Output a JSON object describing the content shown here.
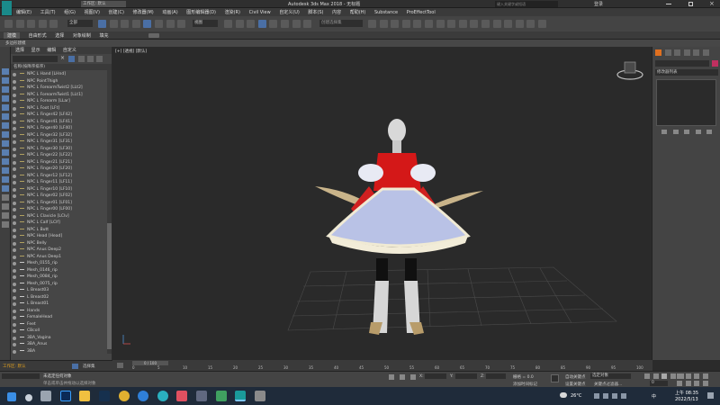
{
  "window": {
    "title": "Autodesk 3ds Max 2018 - 无标题",
    "workspace_label": "工作区: 默认",
    "search_placeholder": "键入关键字或短语",
    "login_label": "登录"
  },
  "menus": [
    "编辑(E)",
    "工具(T)",
    "组(G)",
    "视图(V)",
    "创建(C)",
    "修改器(M)",
    "动画(A)",
    "图形编辑器(D)",
    "渲染(R)",
    "Civil View",
    "自定义(U)",
    "脚本(S)",
    "内容",
    "帮助(H)",
    "Substance",
    "ProEffectTool"
  ],
  "toolbar": {
    "filter_value": "全部",
    "view_value": "视图",
    "named_selection": "创建选择集"
  },
  "ribbon": {
    "tabs": [
      "建模",
      "自由形式",
      "选择",
      "对象绘制",
      "填充"
    ],
    "subtitle": "多边形建模"
  },
  "scene_explorer": {
    "tabs": [
      "选择",
      "显示",
      "编辑",
      "自定义"
    ],
    "header": "名称(按降序排序)",
    "items": [
      "NPC L Hand [LHnd]",
      "NPC PointThigh",
      "NPC L ForearmTwist2 [LLt2]",
      "NPC L ForearmTwist1 [LLt1]",
      "NPC L Forearm [LLar]",
      "NPC L Foot [LFt]",
      "NPC L Finger42 [LF42]",
      "NPC L Finger41 [LF41]",
      "NPC L Finger40 [LF40]",
      "NPC L Finger32 [LF32]",
      "NPC L Finger31 [LF31]",
      "NPC L Finger30 [LF30]",
      "NPC L Finger22 [LF22]",
      "NPC L Finger21 [LF21]",
      "NPC L Finger20 [LF20]",
      "NPC L Finger12 [LF12]",
      "NPC L Finger11 [LF11]",
      "NPC L Finger10 [LF10]",
      "NPC L Finger02 [LF02]",
      "NPC L Finger01 [LF01]",
      "NPC L Finger00 [LF00]",
      "NPC L Clavicle [LClv]",
      "NPC L Calf [LClf]",
      "NPC L Butt",
      "NPC Head [Head]",
      "NPC Belly",
      "NPC Anus Deep2",
      "NPC Anus Deep1",
      "Mesh_0155_rip",
      "Mesh_0146_rip",
      "Mesh_0084_rip",
      "Mesh_0075_rip",
      "L Breast03",
      "L Breast02",
      "L Breast01",
      "Hands",
      "FemaleHead",
      "Feet",
      "CBcoll",
      "3BA_Vagina",
      "3BA_Anus",
      "3BA"
    ],
    "footer_workspace": "工作区: 默认",
    "footer_select": "选择集"
  },
  "viewport": {
    "label": "[+] [透视] [默认]"
  },
  "command_panel": {
    "list_label": "修改器列表"
  },
  "timeline": {
    "frame_display": "0 / 100",
    "ticks": [
      "0",
      "5",
      "10",
      "15",
      "20",
      "25",
      "30",
      "35",
      "40",
      "45",
      "50",
      "55",
      "60",
      "65",
      "70",
      "75",
      "80",
      "85",
      "90",
      "95",
      "100"
    ]
  },
  "status": {
    "left_text": "未选定任何对象",
    "hint": "单击或单击并拖动以选择对象",
    "grid": "栅格 = 0.0",
    "add_time_tag": "添加时间标记",
    "auto_key": "自动关键点",
    "selected_object": "选定对象",
    "set_key": "设置关键点",
    "key_filters": "关键点过滤器...",
    "frame": "0",
    "x_label": "X:",
    "y_label": "Y:",
    "z_label": "Z:"
  },
  "taskbar": {
    "temperature": "26°C",
    "time": "上午 08:35",
    "date": "2022/5/13",
    "lang": "中"
  }
}
